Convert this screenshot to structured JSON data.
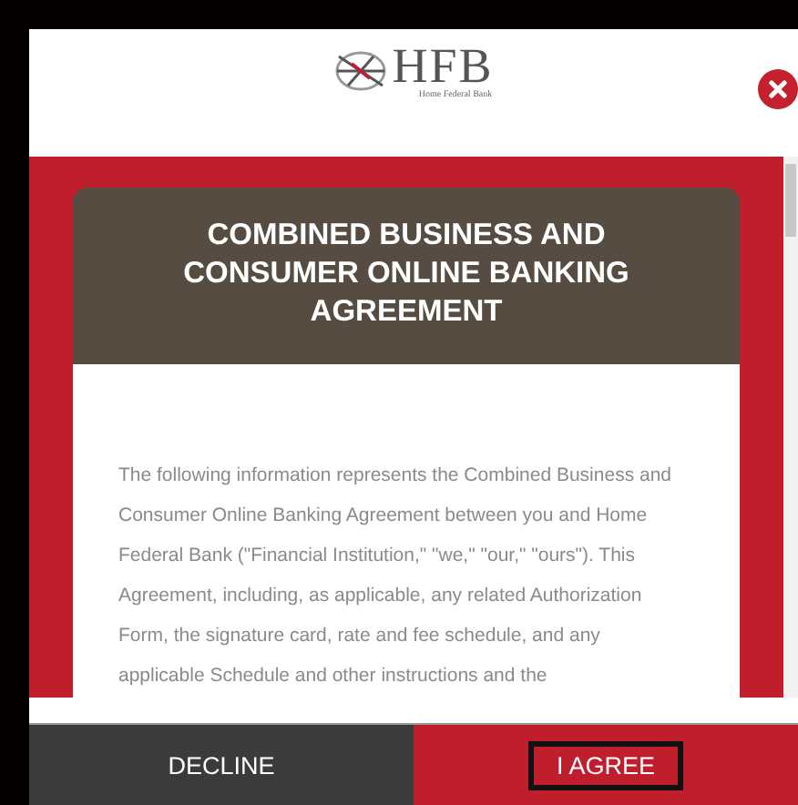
{
  "logo": {
    "mark": "HFB",
    "name": "Home Federal Bank"
  },
  "title": "COMBINED BUSINESS AND CONSUMER ONLINE BANKING AGREEMENT",
  "body": "The following information represents the Combined Business and Consumer Online Banking Agreement between you and Home Federal Bank (\"Financial Institution,\" \"we,\" \"our,\" \"ours\"). This Agreement, including, as applicable, any related Authorization Form, the signature card, rate and fee schedule, and any applicable Schedule and other instructions and the",
  "buttons": [
    {
      "label": "DECLINE",
      "kind": "secondary",
      "focused": false
    },
    {
      "label": "I AGREE",
      "kind": "primary",
      "focused": true
    }
  ]
}
